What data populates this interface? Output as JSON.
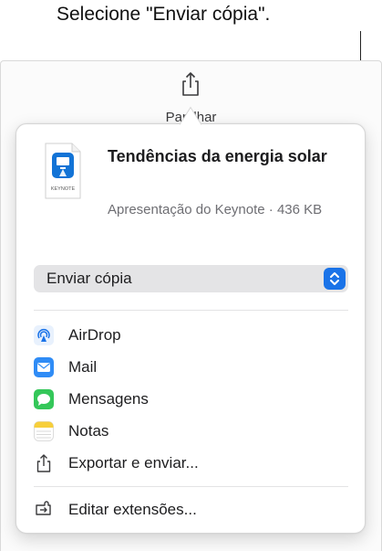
{
  "callout": {
    "text": "Selecione \"Enviar cópia\"."
  },
  "toolbar": {
    "share_label": "Partilhar",
    "share_icon": "share-icon"
  },
  "document": {
    "title": "Tendências da energia solar",
    "subtitle": "Apresentação do Keynote · 436 KB",
    "icon_label": "KEYNOTE"
  },
  "send_option": {
    "selected": "Enviar cópia"
  },
  "menu": {
    "items": [
      {
        "label": "AirDrop",
        "icon": "airdrop-icon"
      },
      {
        "label": "Mail",
        "icon": "mail-icon"
      },
      {
        "label": "Mensagens",
        "icon": "messages-icon"
      },
      {
        "label": "Notas",
        "icon": "notes-icon"
      },
      {
        "label": "Exportar e enviar...",
        "icon": "export-icon"
      }
    ],
    "edit_extensions": {
      "label": "Editar extensões...",
      "icon": "extensions-icon"
    }
  },
  "colors": {
    "accent": "#1a73e8",
    "mail": "#2f8cf6",
    "messages": "#34c759",
    "notes": "#f7cf3b"
  }
}
